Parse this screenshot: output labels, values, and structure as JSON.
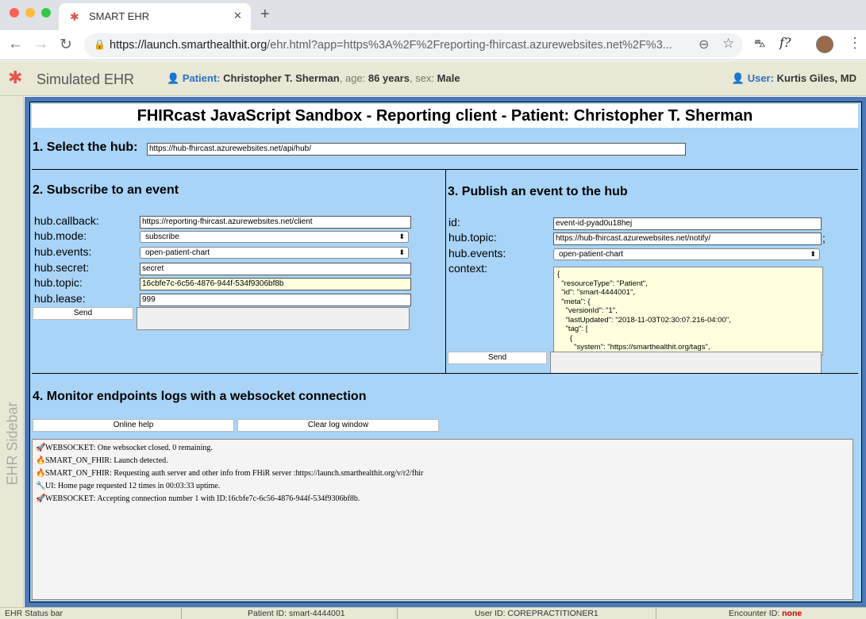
{
  "browser": {
    "tab_title": "SMART EHR",
    "tab_close": "✕",
    "new_tab": "+",
    "url_host": "https://launch.smarthealthit.org",
    "url_rest": "/ehr.html?app=https%3A%2F%2Freporting-fhircast.azurewebsites.net%2F%3...",
    "back": "←",
    "forward": "→",
    "reload": "↻",
    "menu": "⋮"
  },
  "ehr": {
    "title": "Simulated EHR",
    "patient_label": "Patient:",
    "patient_name": "Christopher T. Sherman",
    "age_label": ", age:",
    "age_value": "86 years",
    "sex_label": ", sex:",
    "sex_value": "Male",
    "user_label": "User:",
    "user_name": "Kurtis Giles, MD",
    "sidebar_label": "EHR Sidebar"
  },
  "app": {
    "title": "FHIRcast JavaScript Sandbox - Reporting client - Patient: Christopher T. Sherman",
    "hub": {
      "heading": "1. Select the hub:",
      "url": "https://hub-fhircast.azurewebsites.net/api/hub/"
    },
    "subscribe": {
      "heading": "2. Subscribe to an event",
      "callback_label": "hub.callback:",
      "callback_value": "https://reporting-fhircast.azurewebsites.net/client",
      "mode_label": "hub.mode:",
      "mode_value": "subscribe",
      "events_label": "hub.events:",
      "events_value": "open-patient-chart",
      "secret_label": "hub.secret:",
      "secret_value": "secret",
      "topic_label": "hub.topic:",
      "topic_value": "16cbfe7c-6c56-4876-944f-534f9306bf8b",
      "lease_label": "hub.lease:",
      "lease_value": "999",
      "send_label": "Send"
    },
    "publish": {
      "heading": "3. Publish an event to the hub",
      "id_label": "id:",
      "id_value": "event-id-pyad0u18hej",
      "topic_label": "hub.topic:",
      "topic_value": "https://hub-fhircast.azurewebsites.net/notify/",
      "topic_suffix": ";",
      "events_label": "hub.events:",
      "events_value": "open-patient-chart",
      "context_label": "context:",
      "context_value": "{\n  \"resourceType\": \"Patient\",\n  \"id\": \"smart-4444001\",\n  \"meta\": {\n    \"versionId\": \"1\",\n    \"lastUpdated\": \"2018-11-03T02:30:07.216-04:00\",\n    \"tag\": [\n      {\n        \"system\": \"https://smarthealthit.org/tags\",",
      "send_label": "Send"
    },
    "monitor": {
      "heading": "4. Monitor endpoints logs with a websocket connection",
      "help_label": "Online help",
      "clear_label": "Clear log window",
      "logs": [
        {
          "icon": "🚀",
          "text": "WEBSOCKET:  One websocket closed. 0 remaining."
        },
        {
          "icon": "🔥",
          "text": "SMART_ON_FHIR: Launch detected."
        },
        {
          "icon": "🔥",
          "text": "SMART_ON_FHIR: Requesting auth server and other info from FHiR server :https://launch.smarthealthit.org/v/r2/fhir"
        },
        {
          "icon": "🔧",
          "text": "UI: Home page requested 12 times in 00:03:33 uptime."
        },
        {
          "icon": "🚀",
          "text": "WEBSOCKET: Accepting connection number 1 with ID:16cbfe7c-6c56-4876-944f-534f9306bf8b."
        }
      ]
    }
  },
  "statusbar": {
    "label": "EHR Status bar",
    "patient_id": "Patient ID: smart-4444001",
    "user_id": "User ID: COREPRACTITIONER1",
    "encounter_label": "Encounter ID:",
    "encounter_value": "none"
  },
  "colors": {
    "app_bg": "#a8d4f7",
    "frame": "#4a7ab8",
    "ehr_bg": "#e8e8d4",
    "accent": "#2a6fc9"
  }
}
